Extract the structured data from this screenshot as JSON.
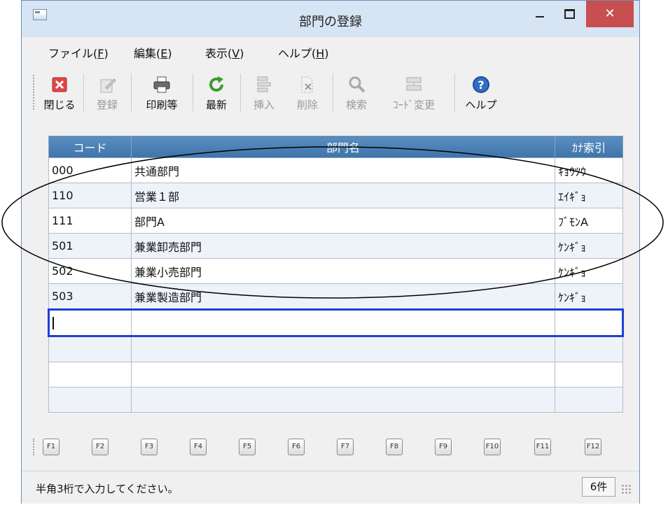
{
  "window": {
    "title": "部門の登録",
    "close_symbol": "✕"
  },
  "menu": [
    {
      "label": "ファイル(",
      "acc": "F",
      "tail": ")"
    },
    {
      "label": "編集(",
      "acc": "E",
      "tail": ")"
    },
    {
      "label": "表示(",
      "acc": "V",
      "tail": ")"
    },
    {
      "label": "ヘルプ(",
      "acc": "H",
      "tail": ")"
    }
  ],
  "toolbar": [
    {
      "label": "閉じる",
      "icon": "close-red-x-icon",
      "enabled": true
    },
    {
      "label": "登録",
      "icon": "register-pencil-icon",
      "enabled": false
    },
    {
      "label": "印刷等",
      "icon": "printer-icon",
      "enabled": true
    },
    {
      "label": "最新",
      "icon": "refresh-icon",
      "enabled": true
    },
    {
      "label": "挿入",
      "icon": "insert-row-icon",
      "enabled": false
    },
    {
      "label": "削除",
      "icon": "delete-row-icon",
      "enabled": false
    },
    {
      "label": "検索",
      "icon": "search-magnifier-icon",
      "enabled": false
    },
    {
      "label": "ｺｰﾄﾞ変更",
      "icon": "code-change-icon",
      "enabled": false
    },
    {
      "label": "ヘルプ",
      "icon": "help-question-icon",
      "enabled": true
    }
  ],
  "grid": {
    "headers": [
      "コード",
      "部門名",
      "ｶﾅ索引"
    ],
    "rows": [
      {
        "code": "000",
        "name": "共通部門",
        "kana": "ｷｮｳﾂｳ"
      },
      {
        "code": "110",
        "name": "営業１部",
        "kana": "ｴｲｷﾞｮ"
      },
      {
        "code": "111",
        "name": "部門A",
        "kana": "ﾌﾞﾓﾝA"
      },
      {
        "code": "501",
        "name": "兼業卸売部門",
        "kana": "ｹﾝｷﾞｮ"
      },
      {
        "code": "502",
        "name": "兼業小売部門",
        "kana": "ｹﾝｷﾞｮ"
      },
      {
        "code": "503",
        "name": "兼業製造部門",
        "kana": "ｹﾝｷﾞｮ"
      }
    ],
    "active_row_empty": true,
    "empty_rows": 3
  },
  "function_keys": [
    "F1",
    "F2",
    "F3",
    "F4",
    "F5",
    "F6",
    "F7",
    "F8",
    "F9",
    "F10",
    "F11",
    "F12"
  ],
  "status": {
    "message": "半角3桁で入力してください。",
    "count": "6件"
  },
  "colors": {
    "header_blue": "#4a80b6",
    "active_border": "#1e3fd6",
    "close_red": "#c74f4f"
  }
}
